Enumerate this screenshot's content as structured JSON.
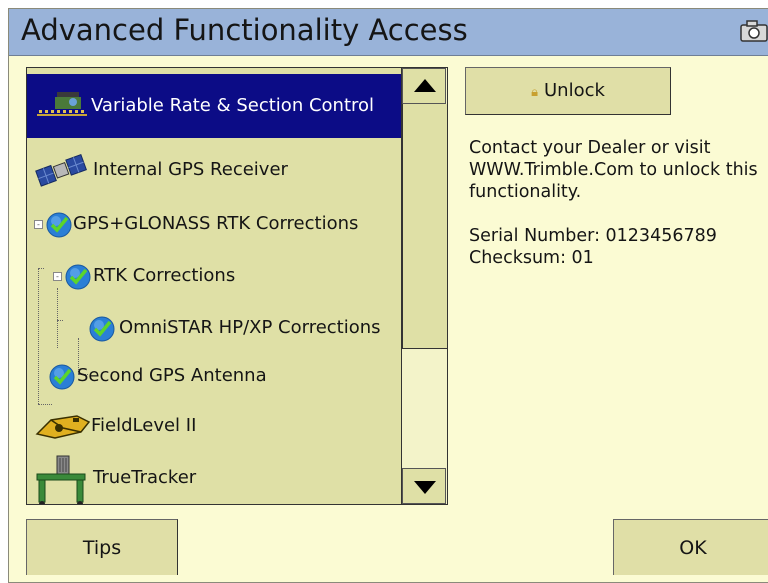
{
  "window": {
    "title": "Advanced Functionality Access",
    "camera_icon": "camera-icon"
  },
  "feature_list": {
    "selected_index": 0,
    "items": [
      {
        "label": "Variable Rate & Section Control",
        "icon": "variable-rate-icon",
        "level": 0,
        "selected": true
      },
      {
        "label": "Internal GPS Receiver",
        "icon": "satellite-icon",
        "level": 0
      },
      {
        "label": "GPS+GLONASS RTK Corrections",
        "icon": "check-badge-icon",
        "level": 1
      },
      {
        "label": "RTK Corrections",
        "icon": "check-badge-icon",
        "level": 2
      },
      {
        "label": "OmniSTAR HP/XP Corrections",
        "icon": "check-badge-icon",
        "level": 3
      },
      {
        "label": "Second GPS Antenna",
        "icon": "check-badge-icon",
        "level": 1
      },
      {
        "label": "FieldLevel II",
        "icon": "fieldlevel-icon",
        "level": 0
      },
      {
        "label": "TrueTracker",
        "icon": "truetracker-icon",
        "level": 0
      }
    ]
  },
  "unlock_button": {
    "label": "Unlock",
    "icon": "lock-icon"
  },
  "info": {
    "contact_text": "Contact your Dealer or visit WWW.Trimble.Com to unlock this functionality.",
    "serial_label": "Serial Number: 0123456789",
    "checksum_label": "Checksum: 01"
  },
  "footer": {
    "tips_label": "Tips",
    "ok_label": "OK"
  },
  "colors": {
    "title_bar": "#99b3d9",
    "background": "#fbfbd3",
    "panel": "#dfe0a6",
    "selection": "#0c0c86",
    "check_blue": "#2a7fd6",
    "check_green": "#5bd52a"
  }
}
